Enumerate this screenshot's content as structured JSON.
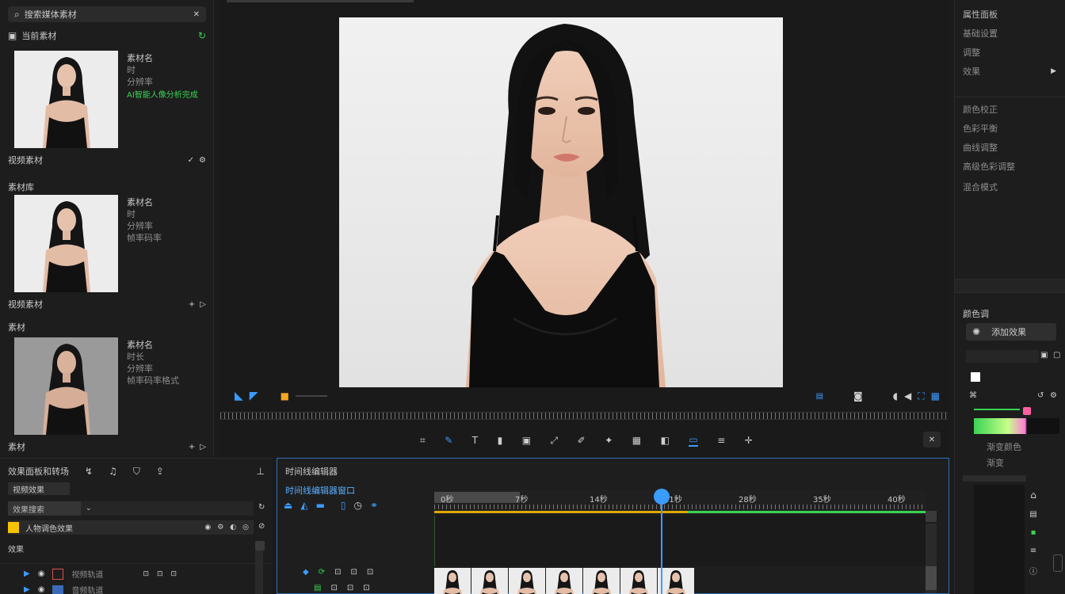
{
  "left_panel": {
    "search_label": "搜索媒体素材",
    "section_title": "当前素材",
    "clips": [
      {
        "title": "素材名",
        "line1": "时",
        "line2": "分辨率",
        "highlight": "AI智能人像分析完成",
        "footer": "视频素材"
      },
      {
        "title": "素材名",
        "line1": "时",
        "line2": "分辨率",
        "line3": "帧率码率",
        "header": "素材库",
        "footer": "视频素材"
      },
      {
        "title": "素材名",
        "line1": "时长",
        "line2": "分辨率",
        "line3": "帧率码率格式",
        "header": "素材",
        "footer": "素材"
      }
    ]
  },
  "center": {
    "tools": [
      "crop",
      "pen",
      "text",
      "mask",
      "shape",
      "transform",
      "brush",
      "filter",
      "grid",
      "adjust",
      "frames",
      "sound",
      "split"
    ]
  },
  "right_panel": {
    "items": [
      "属性面板",
      "基础设置",
      "调整",
      "效果"
    ],
    "sub_items": [
      "颜色校正",
      "色彩平衡",
      "曲线调整",
      "高级色彩调整",
      "混合模式"
    ],
    "section_title": "颜色调",
    "button_label": "添加效果",
    "gradient_label": "渐变颜色",
    "gradient_sub": "渐变"
  },
  "bottom_left": {
    "title": "效果面板和转场",
    "tab_label": "视频效果",
    "search_label": "效果搜索",
    "layer_label": "人物调色效果",
    "group_label": "效果",
    "tracks": [
      {
        "label": "视频轨道"
      },
      {
        "label": "音频轨道"
      }
    ]
  },
  "timeline": {
    "title": "时间线编辑器",
    "prompt": "时间线编辑器窗口",
    "timecodes": [
      "0秒",
      "7秒",
      "14秒",
      "21秒",
      "28秒",
      "35秒",
      "40秒"
    ],
    "clip_count": 7
  },
  "colors": {
    "accent": "#3b9cff",
    "highlight_green": "#39d353",
    "yellow": "#f5c400"
  }
}
